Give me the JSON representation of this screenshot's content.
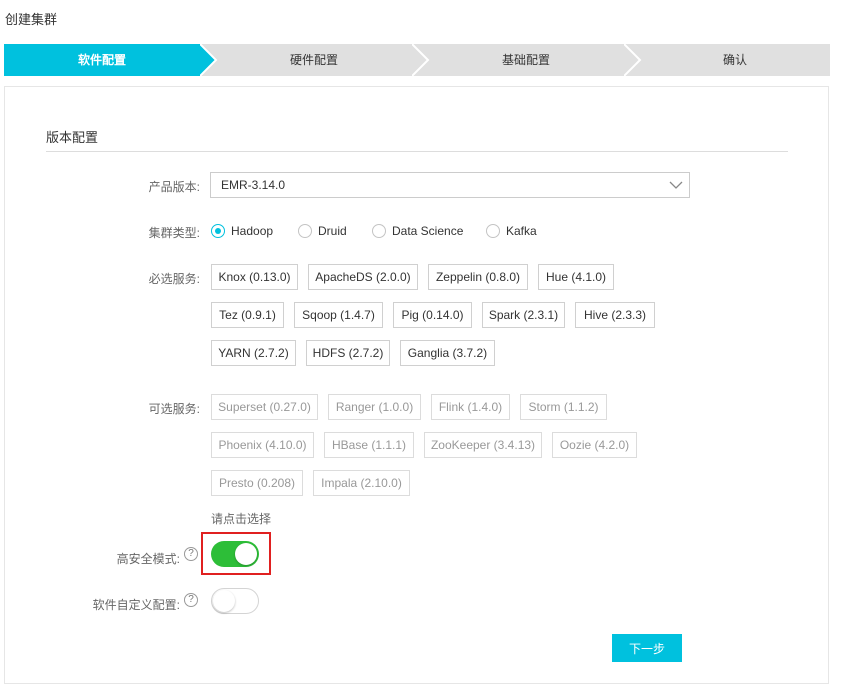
{
  "page": {
    "title": "创建集群"
  },
  "steps": [
    {
      "label": "软件配置",
      "active": true
    },
    {
      "label": "硬件配置",
      "active": false
    },
    {
      "label": "基础配置",
      "active": false
    },
    {
      "label": "确认",
      "active": false
    }
  ],
  "colors": {
    "accent": "#00c1de",
    "inactive_step": "#e0e0e0",
    "toggle_on": "#2dbe38",
    "highlight": "#e02020"
  },
  "section": {
    "title": "版本配置"
  },
  "form": {
    "product_version": {
      "label": "产品版本:",
      "value": "EMR-3.14.0"
    },
    "cluster_type": {
      "label": "集群类型:",
      "options": [
        "Hadoop",
        "Druid",
        "Data Science",
        "Kafka"
      ],
      "selected": "Hadoop"
    },
    "required_services": {
      "label": "必选服务:",
      "items": [
        "Knox (0.13.0)",
        "ApacheDS (2.0.0)",
        "Zeppelin (0.8.0)",
        "Hue (4.1.0)",
        "Tez (0.9.1)",
        "Sqoop (1.4.7)",
        "Pig (0.14.0)",
        "Spark (2.3.1)",
        "Hive (2.3.3)",
        "YARN (2.7.2)",
        "HDFS (2.7.2)",
        "Ganglia (3.7.2)"
      ]
    },
    "optional_services": {
      "label": "可选服务:",
      "items": [
        "Superset (0.27.0)",
        "Ranger (1.0.0)",
        "Flink (1.4.0)",
        "Storm (1.1.2)",
        "Phoenix (4.10.0)",
        "HBase (1.1.1)",
        "ZooKeeper (3.4.13)",
        "Oozie (4.2.0)",
        "Presto (0.208)",
        "Impala (2.10.0)"
      ],
      "hint": "请点击选择"
    },
    "high_security": {
      "label": "高安全模式:",
      "help": "?",
      "enabled": true
    },
    "custom_config": {
      "label": "软件自定义配置:",
      "help": "?",
      "enabled": false
    }
  },
  "actions": {
    "next_label": "下一步"
  }
}
